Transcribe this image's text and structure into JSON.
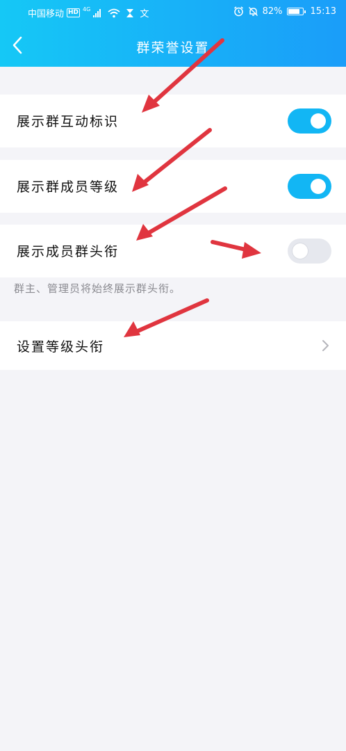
{
  "status_bar": {
    "carrier": "中国移动",
    "network_badge": "HD",
    "network_type": "4G",
    "extra_icon": "文",
    "battery": "82%",
    "time": "15:13",
    "battery_level": 0.82
  },
  "nav": {
    "title": "群荣誉设置"
  },
  "settings": {
    "items": [
      {
        "label": "展示群互动标识",
        "on": true
      },
      {
        "label": "展示群成员等级",
        "on": true
      },
      {
        "label": "展示成员群头衔",
        "on": false
      }
    ],
    "note": "群主、管理员将始终展示群头衔。",
    "link_label": "设置等级头衔"
  },
  "colors": {
    "accent": "#12b6f4",
    "annotation_arrow": "#e0353f",
    "background": "#f4f4f8"
  }
}
